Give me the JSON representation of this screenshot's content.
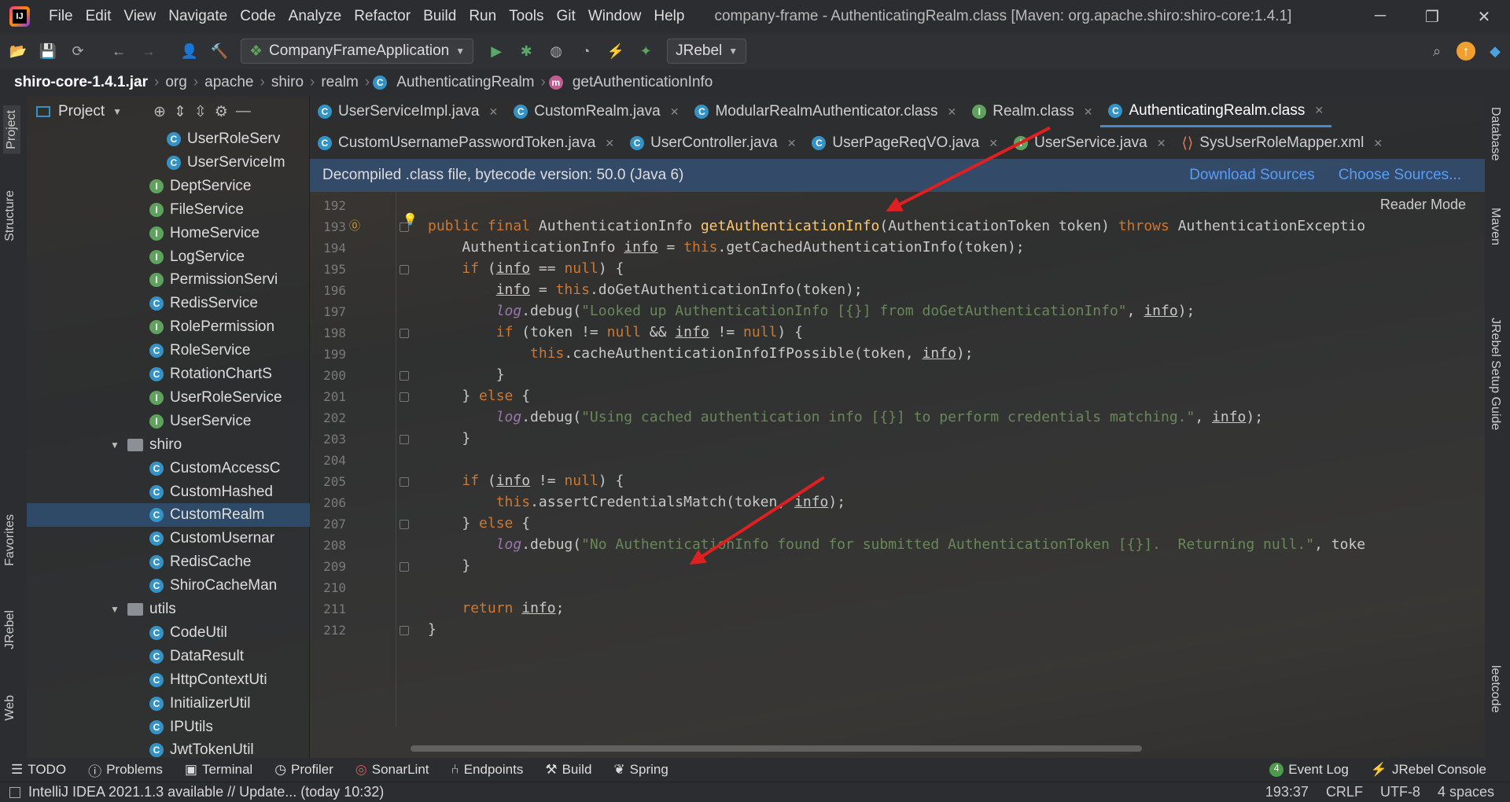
{
  "menubar": {
    "items": [
      "File",
      "Edit",
      "View",
      "Navigate",
      "Code",
      "Analyze",
      "Refactor",
      "Build",
      "Run",
      "Tools",
      "Git",
      "Window",
      "Help"
    ],
    "window_title": "company-frame - AuthenticatingRealm.class [Maven: org.apache.shiro:shiro-core:1.4.1]"
  },
  "toolbar": {
    "run_config": "CompanyFrameApplication",
    "jrebel": "JRebel"
  },
  "breadcrumb": {
    "items": [
      "shiro-core-1.4.1.jar",
      "org",
      "apache",
      "shiro",
      "realm",
      "AuthenticatingRealm",
      "getAuthenticationInfo"
    ]
  },
  "left_tabs": {
    "project": "Project",
    "structure": "Structure",
    "favorites": "Favorites",
    "jrebel": "JRebel",
    "web": "Web"
  },
  "project_panel": {
    "title": "Project",
    "items": [
      {
        "label": "UserRoleServ",
        "type": "c",
        "level": 3
      },
      {
        "label": "UserServiceIm",
        "type": "c",
        "level": 3
      },
      {
        "label": "DeptService",
        "type": "i",
        "level": 2
      },
      {
        "label": "FileService",
        "type": "i",
        "level": 2
      },
      {
        "label": "HomeService",
        "type": "i",
        "level": 2
      },
      {
        "label": "LogService",
        "type": "i",
        "level": 2
      },
      {
        "label": "PermissionServi",
        "type": "i",
        "level": 2
      },
      {
        "label": "RedisService",
        "type": "c",
        "level": 2
      },
      {
        "label": "RolePermission",
        "type": "i",
        "level": 2
      },
      {
        "label": "RoleService",
        "type": "c",
        "level": 2
      },
      {
        "label": "RotationChartS",
        "type": "c",
        "level": 2
      },
      {
        "label": "UserRoleService",
        "type": "i",
        "level": 2
      },
      {
        "label": "UserService",
        "type": "i",
        "level": 2
      },
      {
        "label": "shiro",
        "type": "f",
        "level": 1
      },
      {
        "label": "CustomAccessC",
        "type": "c",
        "level": 2
      },
      {
        "label": "CustomHashed",
        "type": "c",
        "level": 2
      },
      {
        "label": "CustomRealm",
        "type": "c",
        "level": 2,
        "selected": true
      },
      {
        "label": "CustomUsernar",
        "type": "c",
        "level": 2
      },
      {
        "label": "RedisCache",
        "type": "c",
        "level": 2
      },
      {
        "label": "ShiroCacheMan",
        "type": "c",
        "level": 2
      },
      {
        "label": "utils",
        "type": "f",
        "level": 1
      },
      {
        "label": "CodeUtil",
        "type": "c",
        "level": 2
      },
      {
        "label": "DataResult",
        "type": "c",
        "level": 2
      },
      {
        "label": "HttpContextUti",
        "type": "c",
        "level": 2
      },
      {
        "label": "InitializerUtil",
        "type": "c",
        "level": 2
      },
      {
        "label": "IPUtils",
        "type": "c",
        "level": 2
      },
      {
        "label": "JwtTokenUtil",
        "type": "c",
        "level": 2
      }
    ]
  },
  "tabs_row1": [
    {
      "label": "UserServiceImpl.java",
      "icon": "c"
    },
    {
      "label": "CustomRealm.java",
      "icon": "c"
    },
    {
      "label": "ModularRealmAuthenticator.class",
      "icon": "c"
    },
    {
      "label": "Realm.class",
      "icon": "i"
    },
    {
      "label": "AuthenticatingRealm.class",
      "icon": "c",
      "active": true
    }
  ],
  "tabs_row2": [
    {
      "label": "CustomUsernamePasswordToken.java",
      "icon": "c"
    },
    {
      "label": "UserController.java",
      "icon": "c"
    },
    {
      "label": "UserPageReqVO.java",
      "icon": "c"
    },
    {
      "label": "UserService.java",
      "icon": "i"
    },
    {
      "label": "SysUserRoleMapper.xml",
      "icon": "x"
    }
  ],
  "infobar": {
    "text": "Decompiled .class file, bytecode version: 50.0 (Java 6)",
    "download": "Download Sources",
    "choose": "Choose Sources..."
  },
  "editor": {
    "reader_mode": "Reader Mode",
    "lines": [
      {
        "n": "192",
        "t": ""
      },
      {
        "n": "193",
        "t": "public final AuthenticationInfo getAuthenticationInfo(AuthenticationToken token) throws AuthenticationExceptio"
      },
      {
        "n": "194",
        "t": "    AuthenticationInfo info = this.getCachedAuthenticationInfo(token);"
      },
      {
        "n": "195",
        "t": "    if (info == null) {"
      },
      {
        "n": "196",
        "t": "        info = this.doGetAuthenticationInfo(token);"
      },
      {
        "n": "197",
        "t": "        log.debug(\"Looked up AuthenticationInfo [{}] from doGetAuthenticationInfo\", info);"
      },
      {
        "n": "198",
        "t": "        if (token != null && info != null) {"
      },
      {
        "n": "199",
        "t": "            this.cacheAuthenticationInfoIfPossible(token, info);"
      },
      {
        "n": "200",
        "t": "        }"
      },
      {
        "n": "201",
        "t": "    } else {"
      },
      {
        "n": "202",
        "t": "        log.debug(\"Using cached authentication info [{}] to perform credentials matching.\", info);"
      },
      {
        "n": "203",
        "t": "    }"
      },
      {
        "n": "204",
        "t": ""
      },
      {
        "n": "205",
        "t": "    if (info != null) {"
      },
      {
        "n": "206",
        "t": "        this.assertCredentialsMatch(token, info);"
      },
      {
        "n": "207",
        "t": "    } else {"
      },
      {
        "n": "208",
        "t": "        log.debug(\"No AuthenticationInfo found for submitted AuthenticationToken [{}].  Returning null.\", toke"
      },
      {
        "n": "209",
        "t": "    }"
      },
      {
        "n": "210",
        "t": ""
      },
      {
        "n": "211",
        "t": "    return info;"
      },
      {
        "n": "212",
        "t": "}"
      }
    ]
  },
  "right_tabs": {
    "database": "Database",
    "maven": "Maven",
    "jrebel_guide": "JRebel Setup Guide",
    "leetcode": "leetcode"
  },
  "bottom_tools": [
    "TODO",
    "Problems",
    "Terminal",
    "Profiler",
    "SonarLint",
    "Endpoints",
    "Build",
    "Spring"
  ],
  "bottom_right": [
    "Event Log",
    "JRebel Console"
  ],
  "status": {
    "message": "IntelliJ IDEA 2021.1.3 available // Update... (today 10:32)",
    "position": "193:37",
    "line_sep": "CRLF",
    "encoding": "UTF-8",
    "indent": "4 spaces"
  },
  "colors": {
    "accent": "#4a88c7",
    "keyword": "#cc7832",
    "string": "#6a8759",
    "method": "#ffc66d",
    "arrow": "#e02020"
  }
}
